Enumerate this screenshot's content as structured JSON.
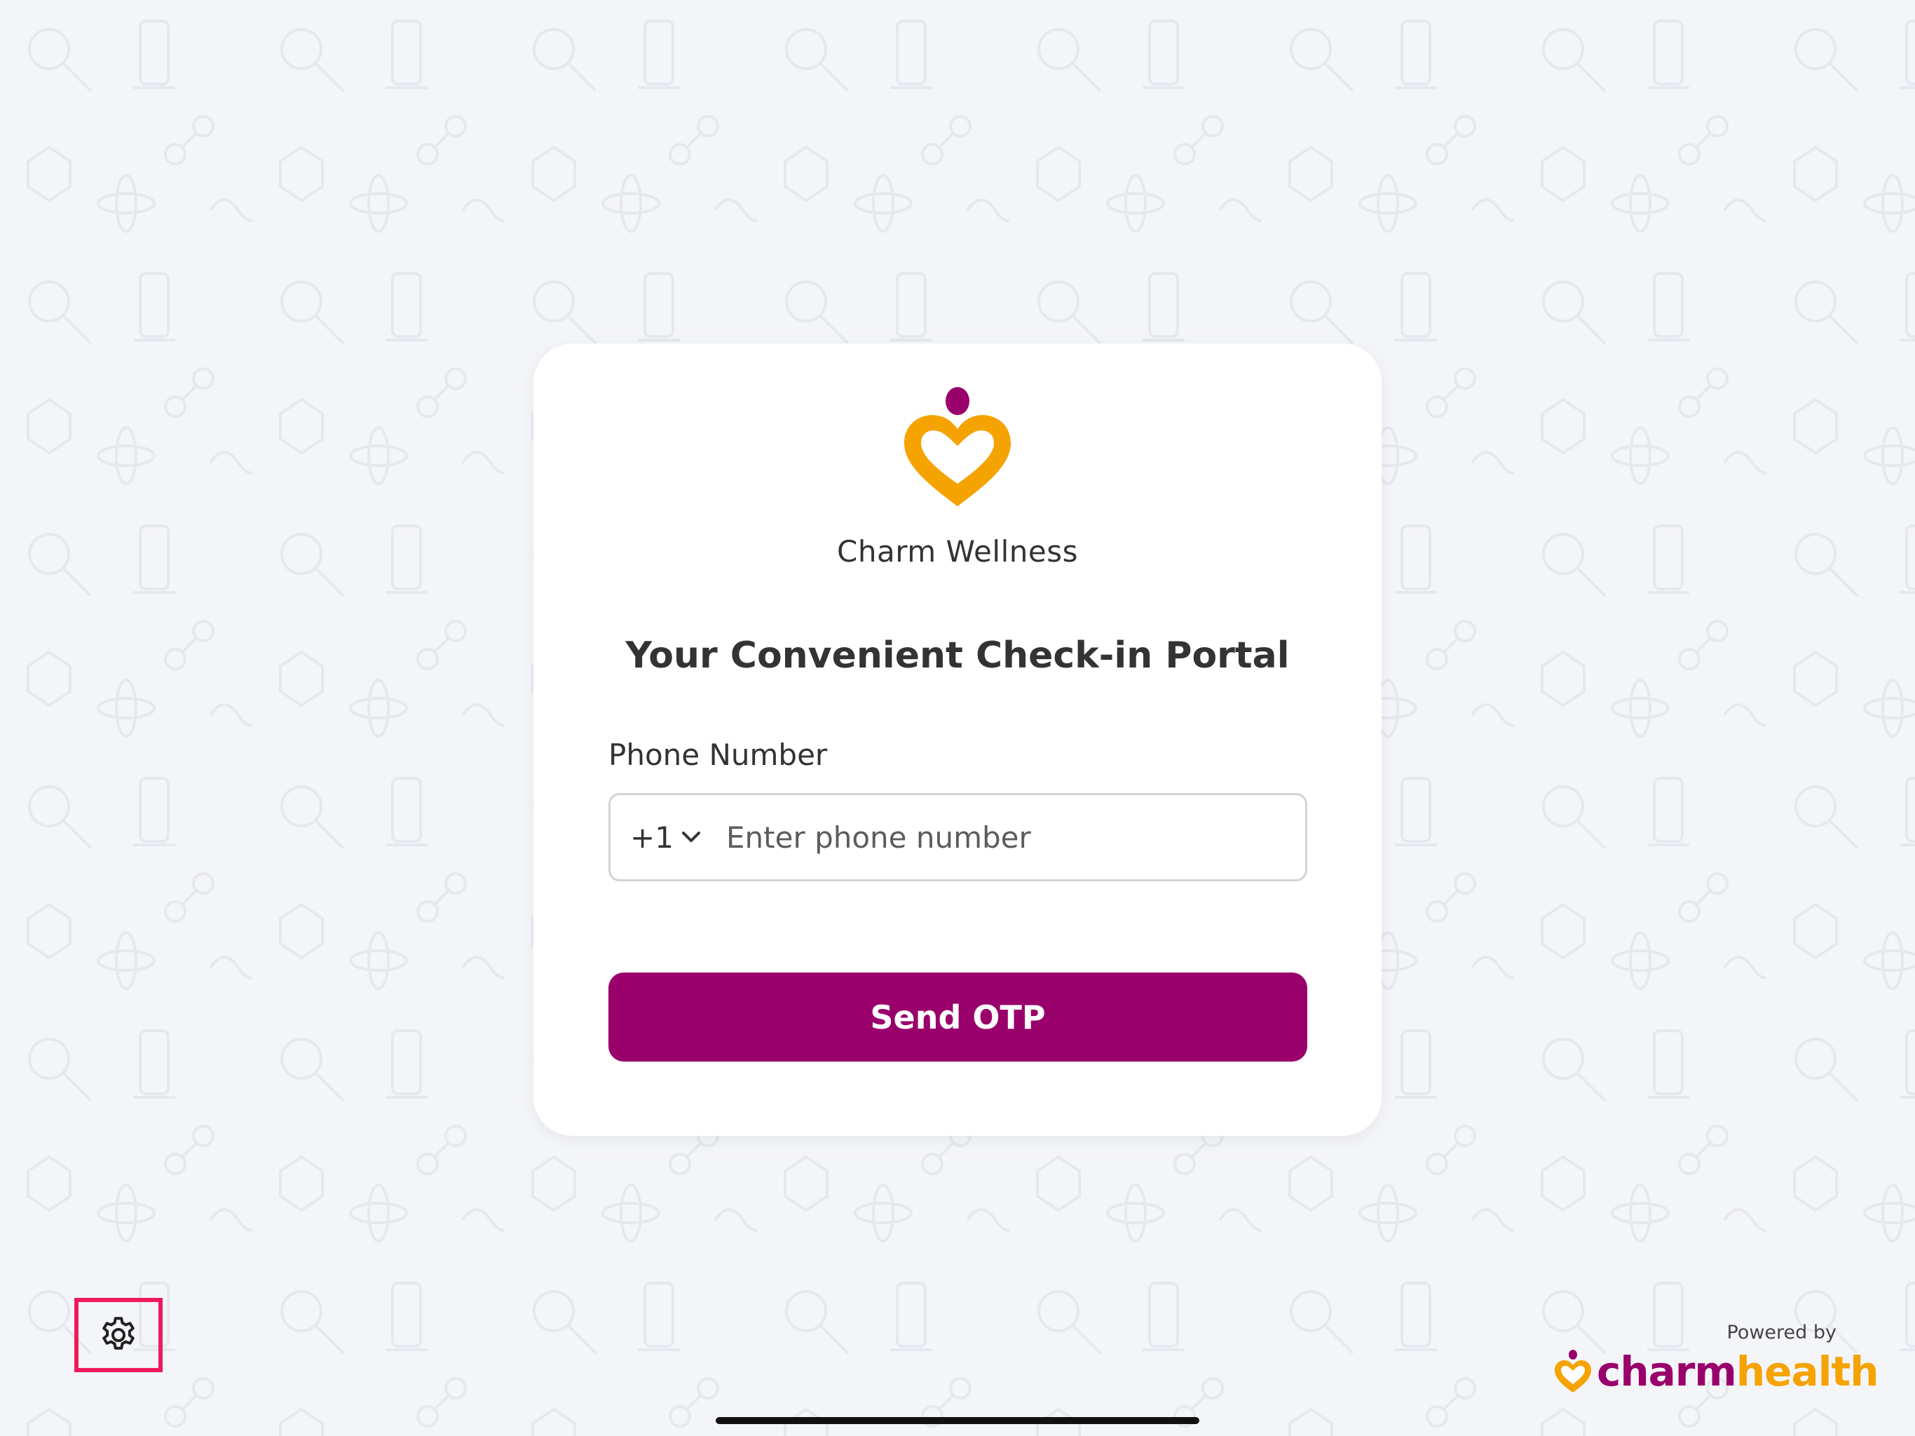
{
  "clinic": {
    "name": "Charm Wellness",
    "logo_icon": "heart-logo-icon"
  },
  "portal": {
    "title": "Your Convenient Check-in Portal"
  },
  "form": {
    "phone_label": "Phone Number",
    "country_code": "+1",
    "phone_value": "",
    "phone_placeholder": "Enter phone number",
    "submit_label": "Send OTP"
  },
  "settings": {
    "icon": "gear-icon"
  },
  "footer": {
    "powered_by": "Powered by",
    "brand_part1": "charm",
    "brand_part2": "health"
  },
  "colors": {
    "accent": "#99006b",
    "logo_orange": "#f5a300",
    "background": "#f4f5f9",
    "highlight": "#f0195c"
  }
}
